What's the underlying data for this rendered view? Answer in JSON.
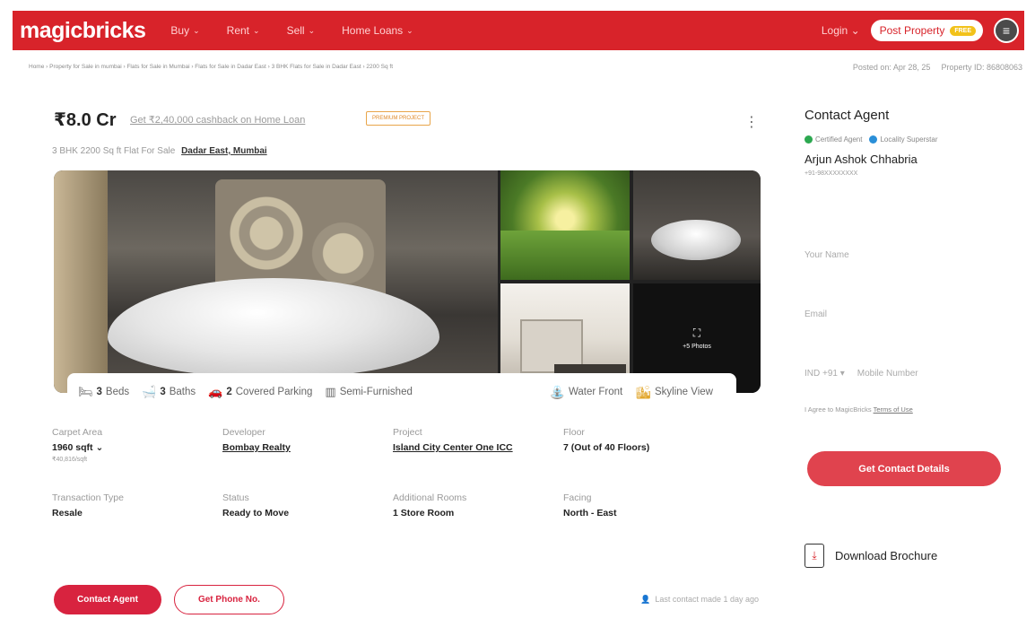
{
  "header": {
    "logo": "magicbricks",
    "nav": [
      "Buy",
      "Rent",
      "Sell",
      "Home Loans"
    ],
    "login": "Login",
    "post_property": "Post Property",
    "free_badge": "FREE",
    "menu_icon": "hamburger-icon",
    "accent_color": "#d8232a"
  },
  "breadcrumb": "Home › Property for Sale in mumbai › Flats for Sale in Mumbai › Flats for Sale in Dadar East › 3 BHK Flats for Sale in Dadar East › 2200 Sq ft",
  "meta": {
    "posted_on": "Posted on: Apr 28, 25",
    "property_id": "Property ID: 86808063"
  },
  "listing": {
    "price": "₹8.0 Cr",
    "cashback": "Get ₹2,40,000 cashback on Home Loan",
    "premium_badge": "PREMIUM PROJECT",
    "subtitle": "3 BHK 2200 Sq ft Flat For Sale",
    "location": "Dadar East, Mumbai",
    "more_photos": "+5 Photos"
  },
  "amenities": {
    "beds_num": "3",
    "beds_label": "Beds",
    "baths_num": "3",
    "baths_label": "Baths",
    "parking_num": "2",
    "parking_label": "Covered Parking",
    "furnishing": "Semi-Furnished",
    "water_front": "Water Front",
    "skyline": "Skyline View"
  },
  "details": {
    "carpet_area_label": "Carpet Area",
    "carpet_area": "1960 sqft",
    "carpet_rate": "₹40,816/sqft",
    "developer_label": "Developer",
    "developer": "Bombay Realty",
    "project_label": "Project",
    "project": "Island City Center One ICC",
    "floor_label": "Floor",
    "floor": "7 (Out of 40 Floors)",
    "transaction_label": "Transaction Type",
    "transaction": "Resale",
    "status_label": "Status",
    "status": "Ready to Move",
    "rooms_label": "Additional Rooms",
    "rooms": "1 Store Room",
    "facing_label": "Facing",
    "facing": "North - East"
  },
  "actions": {
    "contact_agent": "Contact Agent",
    "get_phone": "Get Phone No.",
    "last_contact": "Last contact made 1 day ago"
  },
  "contact_panel": {
    "title": "Contact Agent",
    "certified": "Certified Agent",
    "locality": "Locality Superstar",
    "agent_name": "Arjun Ashok Chhabria",
    "agent_phone": "+91-98XXXXXXXX",
    "name_placeholder": "Your Name",
    "email_placeholder": "Email",
    "country_code": "IND +91",
    "mobile_placeholder": "Mobile Number",
    "terms_prefix": "I Agree to MagicBricks",
    "terms_link": "Terms of Use",
    "cta": "Get Contact Details",
    "brochure": "Download Brochure"
  }
}
